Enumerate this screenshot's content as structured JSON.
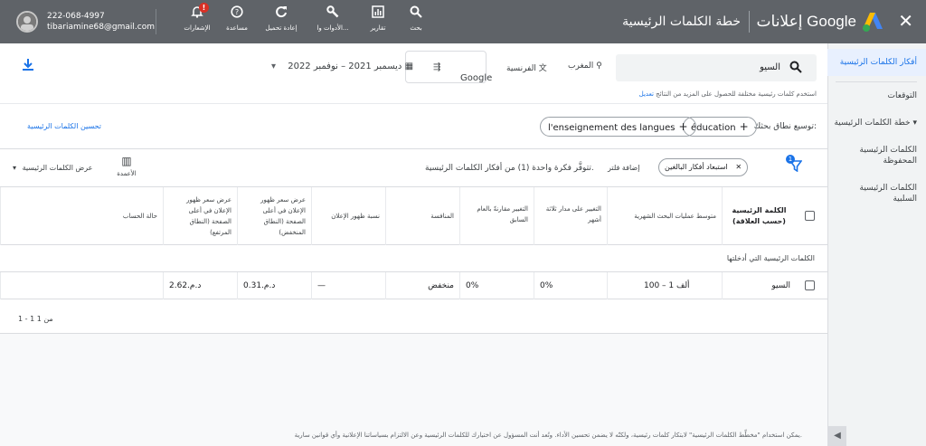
{
  "topbar": {
    "product": "إعلانات Google",
    "page_title": "خطة الكلمات الرئيسية",
    "tools": [
      {
        "label": "بحث",
        "icon": "search-icon"
      },
      {
        "label": "تقارير",
        "icon": "bar-chart-icon"
      },
      {
        "label": "الأدوات وا...",
        "icon": "wrench-icon"
      },
      {
        "label": "إعادة تحميل",
        "icon": "refresh-icon"
      },
      {
        "label": "مساعدة",
        "icon": "help-icon"
      },
      {
        "label": "الإشعارات",
        "icon": "bell-icon",
        "badge": "!"
      }
    ],
    "account": {
      "id": "222-068-4997",
      "email": "tibariamine68@gmail.com"
    }
  },
  "sidebar": {
    "items": [
      {
        "label": "أفكار الكلمات الرئيسية",
        "active": true
      },
      {
        "label": "التوقعات"
      },
      {
        "label": "خطة الكلمات الرئيسية"
      },
      {
        "label": "الكلمات الرئيسية المحفوظة"
      },
      {
        "label": "الكلمات الرئيسية السلبية"
      }
    ],
    "collapse_icon": "chevron-left-icon"
  },
  "search": {
    "query": "السيو",
    "location": "المغرب",
    "language": "الفرنسية",
    "engine": "Google",
    "date_range": "ديسمبر 2021 – نوفمبر 2022",
    "hint": "استخدم كلمات رئيسية مختلفة للحصول على المزيد من النتائج",
    "hint_link": "تعديل"
  },
  "refine": {
    "label": "توسيع نطاق بحثك:",
    "chips": [
      "éducation",
      "l'enseignement des langues"
    ],
    "link": "تحسين الكلمات الرئيسية"
  },
  "filters": {
    "badge": "1",
    "exclude_chip": "استبعاد أفكار البالغين",
    "add_filter": "إضافة فلتر",
    "summary": "تتوفَّر فكرة واحدة (1) من أفكار الكلمات الرئيسية.",
    "columns_label": "الأعمدة",
    "view_label": "عرض الكلمات الرئيسية"
  },
  "table": {
    "headers": {
      "keyword": "الكلمة الرئيسية (حسب العلاقة)",
      "avg_searches": "متوسط عمليات البحث الشهرية",
      "three_month": "التغيير على مدار ثلاثة أشهر",
      "yoy": "التغيير مقارنةً بالعام السابق",
      "competition": "المنافسة",
      "impr_share": "نسبة ظهور الإعلان",
      "bid_low": "عرض سعر ظهور الإعلان في أعلى الصفحة (النطاق المنخفض)",
      "bid_high": "عرض سعر ظهور الإعلان في أعلى الصفحة (النطاق المرتفع)",
      "account_status": "حالة الحساب"
    },
    "group_label": "الكلمات الرئيسية التي أدخلتها",
    "rows": [
      {
        "keyword": "السيو",
        "avg_searches": "100 – 1 ألف",
        "three_month": "0%",
        "yoy": "0%",
        "competition": "منخفض",
        "impr_share": "—",
        "bid_low": "د.م.‏0.31",
        "bid_high": "د.م.‏2.62",
        "account_status": ""
      }
    ],
    "pager": "1 - 1 من 1"
  },
  "footer": {
    "note": "يمكن استخدام \"مخطِّط الكلمات الرئيسية\" لابتكار كلمات رئيسية، ولكنّه لا يضمن تحسين الأداء. وتُعد أنت المسؤول عن اختيارك للكلمات الرئيسية وعن الالتزام بسياساتنا الإعلانية وأي قوانين سارية."
  },
  "colors": {
    "topbar": "#5f6368",
    "accent": "#1a73e8",
    "sidebar": "#f1f3f4"
  }
}
